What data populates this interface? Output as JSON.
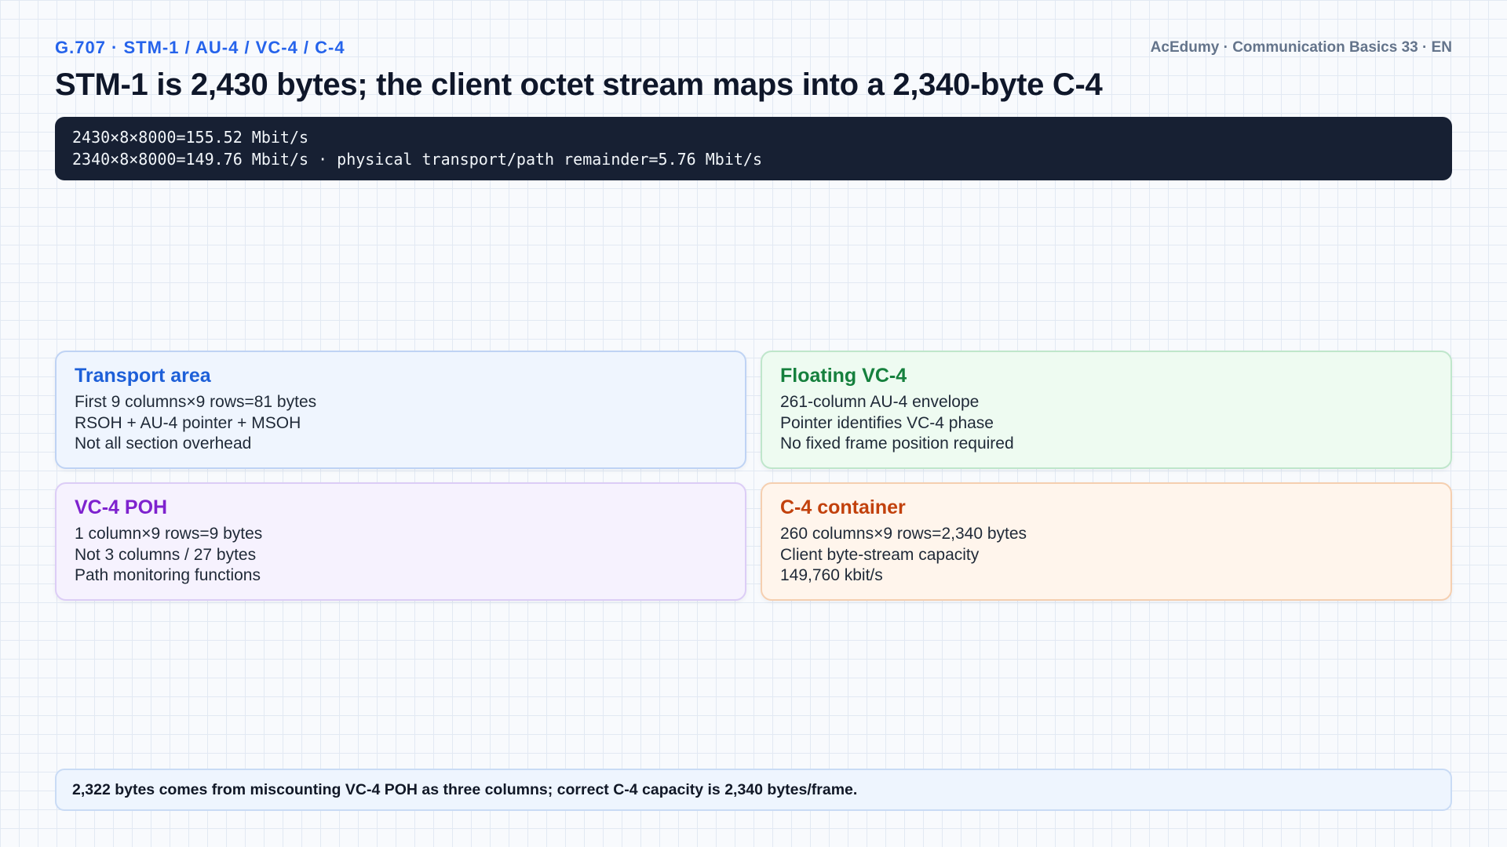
{
  "header": {
    "kicker": "G.707 · STM-1 / AU-4 / VC-4 / C-4",
    "brand": "AcEdumy · Communication Basics 33 · EN",
    "title": "STM-1 is 2,430 bytes; the client octet stream maps into a 2,340-byte C-4"
  },
  "formula": {
    "lines": [
      "2430×8×8000=155.52 Mbit/s",
      "2340×8×8000=149.76 Mbit/s · physical transport/path remainder=5.76 Mbit/s"
    ]
  },
  "cards": [
    {
      "title": "Transport area",
      "color": "#1d5fd8",
      "lines": [
        "First 9 columns×9 rows=81 bytes",
        "RSOH + AU-4 pointer + MSOH",
        "Not all section overhead"
      ]
    },
    {
      "title": "Floating VC-4",
      "color": "#15803d",
      "lines": [
        "261-column AU-4 envelope",
        "Pointer identifies VC-4 phase",
        "No fixed frame position required"
      ]
    },
    {
      "title": "VC-4 POH",
      "color": "#7e22ce",
      "lines": [
        "1 column×9 rows=9 bytes",
        "Not 3 columns / 27 bytes",
        "Path monitoring functions"
      ]
    },
    {
      "title": "C-4 container",
      "color": "#c2410c",
      "lines": [
        "260 columns×9 rows=2,340 bytes",
        "Client byte-stream capacity",
        "149,760 kbit/s"
      ]
    }
  ],
  "note": {
    "text": "2,322 bytes comes from miscounting VC-4 POH as three columns; correct C-4 capacity is 2,340 bytes/frame."
  }
}
